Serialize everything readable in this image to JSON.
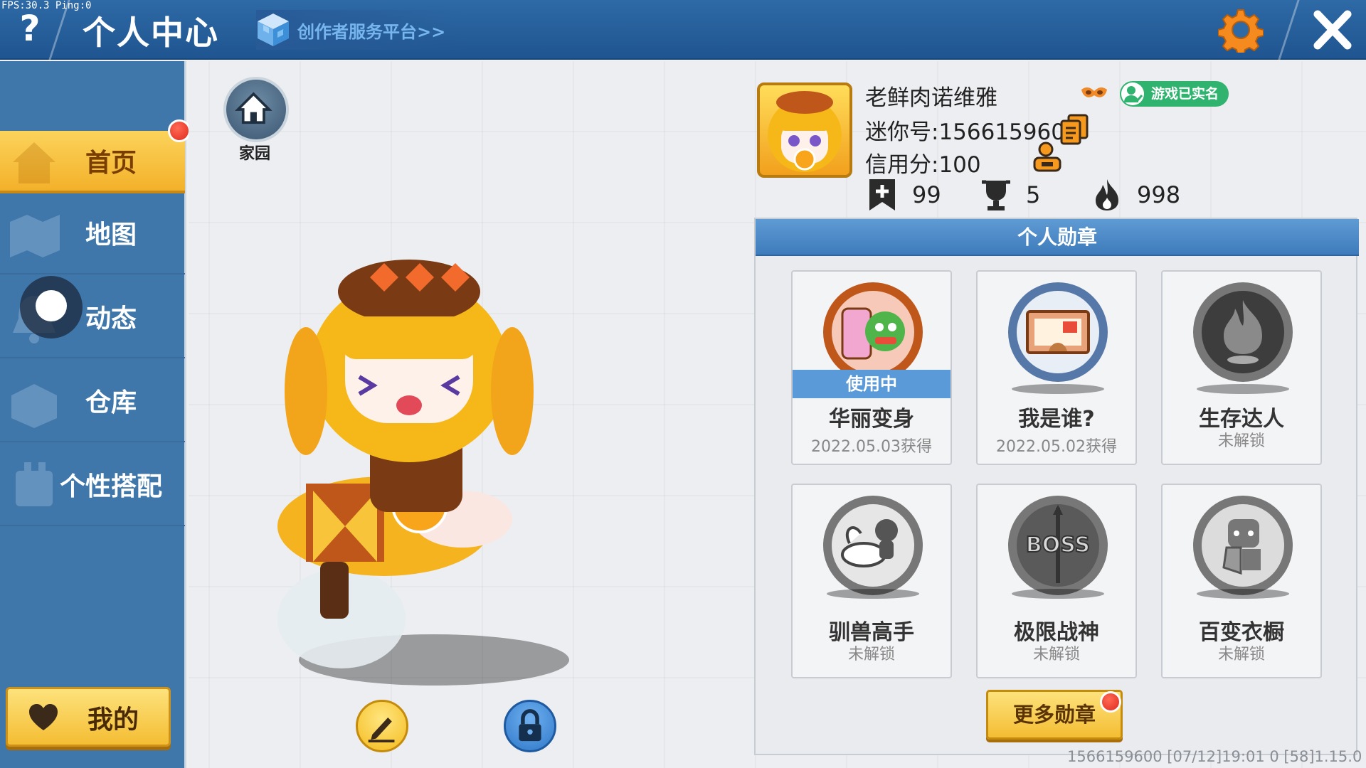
{
  "debug": {
    "fps": "FPS:30.3  Ping:0"
  },
  "topbar": {
    "help_label": "?",
    "title": "个人中心",
    "creator_link": "创作者服务平台>>"
  },
  "sidebar": {
    "items": [
      {
        "label": "首页",
        "icon": "house-icon"
      },
      {
        "label": "地图",
        "icon": "map-icon"
      },
      {
        "label": "动态",
        "icon": "bell-icon"
      },
      {
        "label": "仓库",
        "icon": "box-icon"
      },
      {
        "label": "个性搭配",
        "icon": "shirt-icon"
      }
    ],
    "my_label": "我的"
  },
  "home": {
    "label": "家园"
  },
  "profile": {
    "name": "老鲜肉诺维雅",
    "verified": "游戏已实名",
    "mini_id": "迷你号:1566159600",
    "credit": "信用分:100",
    "stats": [
      {
        "icon": "bookmark-plus-icon",
        "value": "99"
      },
      {
        "icon": "trophy-icon",
        "value": "5"
      },
      {
        "icon": "flame-icon",
        "value": "998"
      }
    ]
  },
  "medals": {
    "header": "个人勋章",
    "items": [
      {
        "name": "华丽变身",
        "sub": "2022.05.03获得",
        "in_use": "使用中"
      },
      {
        "name": "我是谁?",
        "sub": "2022.05.02获得"
      },
      {
        "name": "生存达人",
        "sub": "未解锁"
      },
      {
        "name": "驯兽高手",
        "sub": "未解锁"
      },
      {
        "name": "极限战神",
        "sub": "未解锁"
      },
      {
        "name": "百变衣橱",
        "sub": "未解锁"
      }
    ],
    "more_label": "更多勋章"
  },
  "footer": {
    "info": "1566159600   [07/12]19:01 0  [58]1.15.0"
  },
  "colors": {
    "topbar": "#2e6aa6",
    "sidebar": "#3f77ab",
    "accent_yellow": "#f4bd33",
    "verified_green": "#2fb36e",
    "settings_orange": "#f58a1f"
  }
}
